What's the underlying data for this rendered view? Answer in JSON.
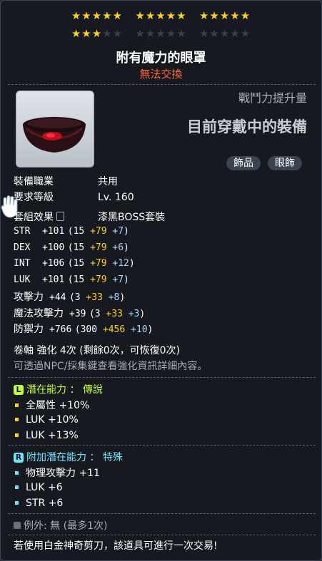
{
  "stars": {
    "row1": [
      5,
      5,
      5
    ],
    "row2_filled": 3,
    "row2": [
      5,
      5,
      5
    ]
  },
  "item": {
    "name": "附有魔力的眼罩",
    "trade_status": "無法交換"
  },
  "combat_label": "戰鬥力提升量",
  "equipped_label": "目前穿戴中的裝備",
  "tags": [
    "飾品",
    "眼飾"
  ],
  "info": {
    "job_label": "裝備職業",
    "job_value": "共用",
    "level_label": "要求等級",
    "level_value": "Lv. 160",
    "set_label": "套組效果",
    "set_value": "漆黑BOSS套裝"
  },
  "stats": [
    {
      "name": "STR",
      "total": "+101",
      "base": "15",
      "bonus": "+79",
      "enh": "+7"
    },
    {
      "name": "DEX",
      "total": "+100",
      "base": "15",
      "bonus": "+79",
      "enh": "+6"
    },
    {
      "name": "INT",
      "total": "+106",
      "base": "15",
      "bonus": "+79",
      "enh": "+12"
    },
    {
      "name": "LUK",
      "total": "+101",
      "base": "15",
      "bonus": "+79",
      "enh": "+7"
    },
    {
      "name": "攻擊力",
      "total": "+44",
      "base": "3",
      "bonus": "+33",
      "enh": "+8"
    },
    {
      "name": "魔法攻擊力",
      "total": "+39",
      "base": "3",
      "bonus": "+33",
      "enh": "+3"
    },
    {
      "name": "防禦力",
      "total": "+766",
      "base": "300",
      "bonus": "+456",
      "enh": "+10"
    }
  ],
  "scroll_text": "卷軸 強化 4次 (剩餘0次，可恢復0次)",
  "hint_text": "可透過NPC/採集鍵查看強化資訊詳細內容。",
  "potential": {
    "badge": "L",
    "label": "潛在能力",
    "colon": "：",
    "grade": "傳說",
    "lines": [
      "全屬性 +10%",
      "LUK +10%",
      "LUK +13%"
    ]
  },
  "bonus_potential": {
    "badge": "R",
    "label": "附加潛在能力",
    "colon": "：",
    "grade": "特殊",
    "lines": [
      "物理攻擊力 +11",
      "LUK +6",
      "STR +6"
    ]
  },
  "exception": {
    "label": "例外:",
    "value": "無 (最多1次)"
  },
  "footer_text": "若使用白金神奇剪刀，該道具可進行一次交易!",
  "colors": {
    "star": "#ffd21a",
    "legendary": "#c6ff3a",
    "unique": "#6ee6ff",
    "untradeable": "#ff6a3a"
  }
}
